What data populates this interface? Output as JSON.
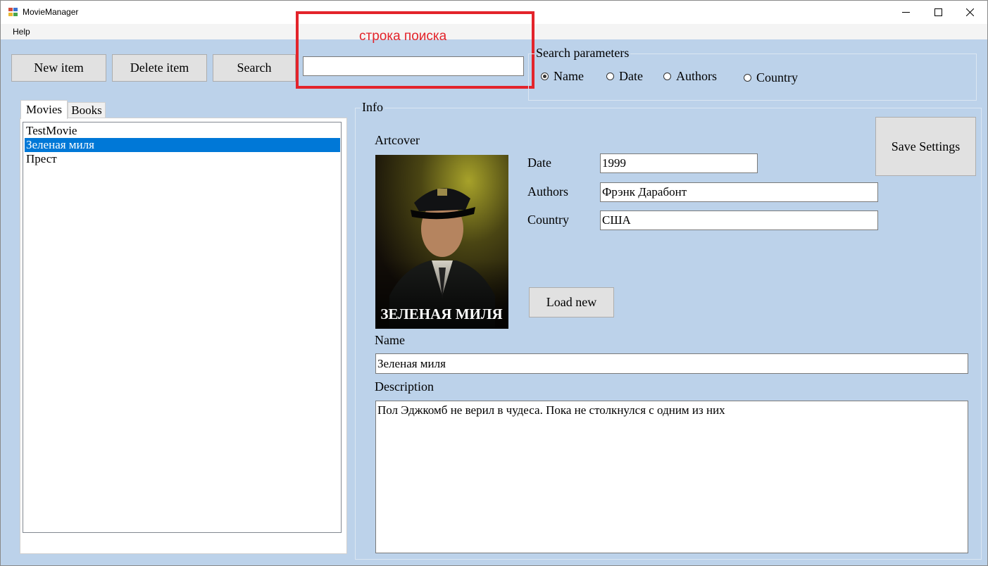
{
  "window": {
    "title": "MovieManager"
  },
  "menu": {
    "help": "Help"
  },
  "toolbar": {
    "new_item": "New item",
    "delete_item": "Delete item",
    "search": "Search",
    "search_value": ""
  },
  "annotation": {
    "text": "строка поиска",
    "color": "#e3242b"
  },
  "search_params": {
    "title": "Search parameters",
    "options": [
      "Name",
      "Date",
      "Authors",
      "Country"
    ],
    "selected": "Name"
  },
  "tabs": {
    "movies": "Movies",
    "books": "Books",
    "active": "Movies"
  },
  "list": {
    "items": [
      "TestMovie",
      "Зеленая миля",
      "Прест"
    ],
    "selected_index": 1
  },
  "info": {
    "title": "Info",
    "artcover_label": "Artcover",
    "poster_text": "ЗЕЛЕНАЯ МИЛЯ",
    "date_label": "Date",
    "date_value": "1999",
    "authors_label": "Authors",
    "authors_value": "Фрэнк Дарабонт",
    "country_label": "Country",
    "country_value": "США",
    "load_new": "Load new",
    "save_settings": "Save Settings",
    "name_label": "Name",
    "name_value": "Зеленая миля",
    "description_label": "Description",
    "description_value": "Пол Эджкомб не верил в чудеса. Пока не столкнулся с одним из них"
  },
  "colors": {
    "accent": "#0078d7",
    "window_bg": "#bcd2ea"
  }
}
